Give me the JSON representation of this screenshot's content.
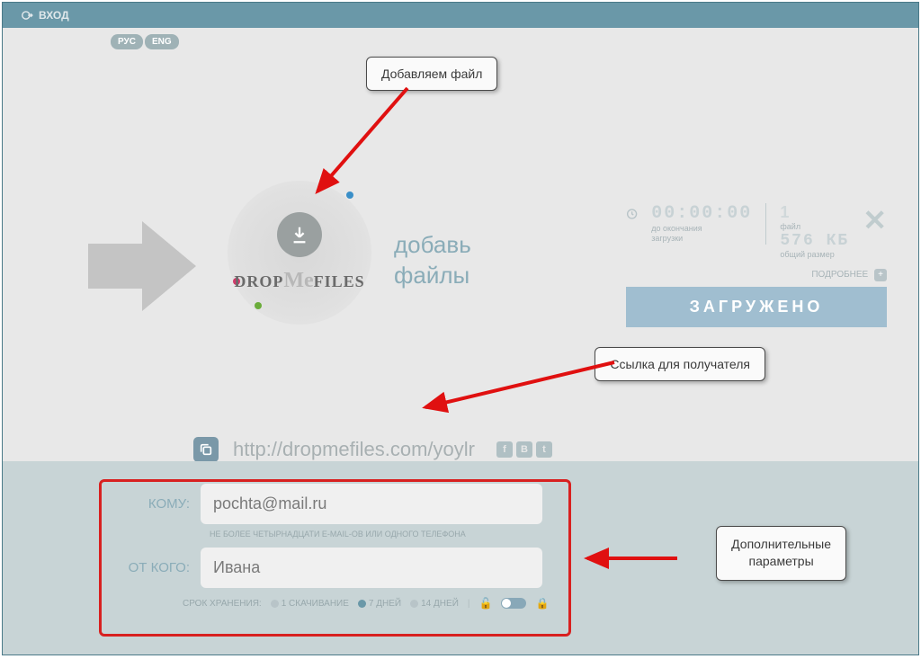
{
  "topbar": {
    "login": "ВХОД"
  },
  "lang": {
    "ru": "РУС",
    "en": "ENG"
  },
  "logo": {
    "drop": "DROP",
    "me": "Me",
    "files": "FILES"
  },
  "add_files": {
    "line1": "добавь",
    "line2": "файлы"
  },
  "status": {
    "time": "00:00:00",
    "time_sub1": "до окончания",
    "time_sub2": "загрузки",
    "file_count": "1",
    "file_label": "файл",
    "size": "576 КБ",
    "size_label": "общий размер",
    "more": "ПОДРОБНЕЕ",
    "loaded": "ЗАГРУЖЕНО"
  },
  "link": {
    "url": "http://dropmefiles.com/yoylr"
  },
  "form": {
    "to_label": "КОМУ:",
    "to_value": "pochta@mail.ru",
    "hint": "НЕ БОЛЕЕ ЧЕТЫРНАДЦАТИ E-MAIL-ОВ ИЛИ ОДНОГО ТЕЛЕФОНА",
    "from_label": "ОТ КОГО:",
    "from_value": "Ивана"
  },
  "storage": {
    "label": "СРОК ХРАНЕНИЯ:",
    "opt1": "1 СКАЧИВАНИЕ",
    "opt2": "7 ДНЕЙ",
    "opt3": "14 ДНЕЙ"
  },
  "callouts": {
    "c1": "Добавляем файл",
    "c2": "Ссылка для получателя",
    "c3a": "Дополнительные",
    "c3b": "параметры"
  }
}
